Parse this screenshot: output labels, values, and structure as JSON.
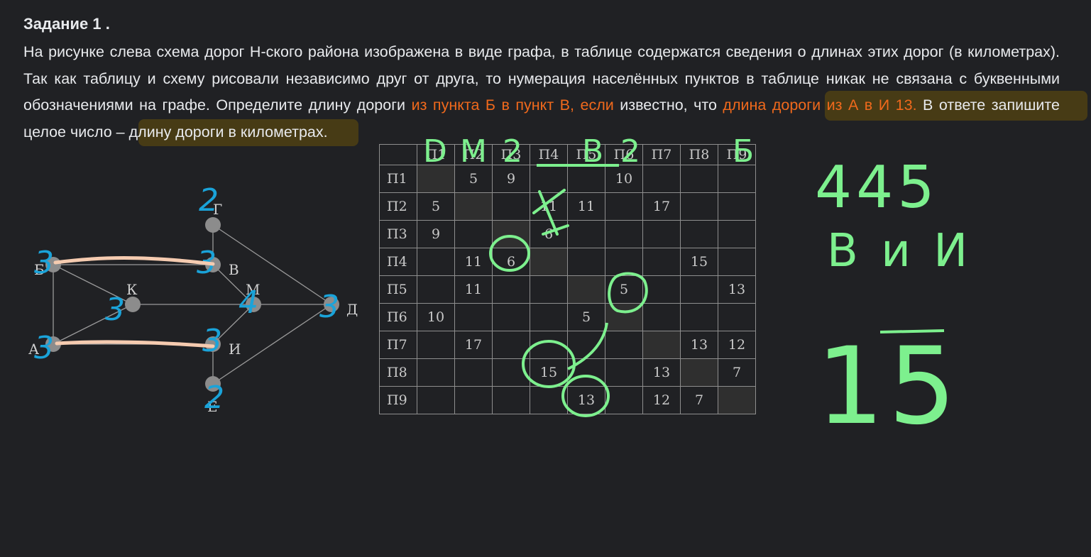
{
  "task": {
    "title": "Задание 1 .",
    "text_1": "На рисунке слева схема дорог Н-ского района изображена в виде графа, в таблице содержатся сведения о длинах этих дорог (в километрах). Так как таблицу и схему рисовали независимо друг от друга, то нумерация населённых пунктов в таблице никак не связана с буквенными обозначениями на графе. Определите длину дороги ",
    "highlight_1": "из пункта Б в пункт В, если",
    "text_2": " известно, что ",
    "highlight_2": "длина дороги из А в И 13.",
    "text_3": " В ответе запишите целое число – длину дороги в километрах."
  },
  "colors": {
    "background": "#202124",
    "text": "#e8eaed",
    "highlight": "#f0691c",
    "ink_green": "#7df08e",
    "ink_blue": "#1aa3d9",
    "ink_peach": "#f5cbb0"
  },
  "graph": {
    "nodes": [
      {
        "id": "Г",
        "label": "Г"
      },
      {
        "id": "Б",
        "label": "Б"
      },
      {
        "id": "В",
        "label": "В"
      },
      {
        "id": "К",
        "label": "К"
      },
      {
        "id": "М",
        "label": "М"
      },
      {
        "id": "Д",
        "label": "Д"
      },
      {
        "id": "А",
        "label": "А"
      },
      {
        "id": "И",
        "label": "И"
      },
      {
        "id": "Е",
        "label": "Е"
      }
    ],
    "edges": [
      [
        "Б",
        "В"
      ],
      [
        "Б",
        "К"
      ],
      [
        "Б",
        "А"
      ],
      [
        "Г",
        "В"
      ],
      [
        "Г",
        "Д"
      ],
      [
        "В",
        "М"
      ],
      [
        "К",
        "М"
      ],
      [
        "М",
        "Д"
      ],
      [
        "К",
        "А"
      ],
      [
        "А",
        "И"
      ],
      [
        "И",
        "М"
      ],
      [
        "И",
        "Е"
      ],
      [
        "Е",
        "Д"
      ]
    ],
    "annotations": {
      "degree_Г": "2",
      "degree_Б": "3",
      "degree_В": "3",
      "degree_К": "3",
      "degree_М": "4",
      "degree_Д": "3",
      "degree_А": "3",
      "degree_И": "3",
      "degree_Е": "2"
    }
  },
  "table": {
    "headers": [
      "П1",
      "П2",
      "П3",
      "П4",
      "П5",
      "П6",
      "П7",
      "П8",
      "П9"
    ],
    "rows": [
      [
        "",
        "5",
        "9",
        "",
        "",
        "10",
        "",
        "",
        ""
      ],
      [
        "5",
        "",
        "",
        "11",
        "11",
        "",
        "17",
        "",
        ""
      ],
      [
        "9",
        "",
        "",
        "6",
        "",
        "",
        "",
        "",
        ""
      ],
      [
        "",
        "11",
        "6",
        "",
        "",
        "",
        "",
        "15",
        ""
      ],
      [
        "",
        "11",
        "",
        "",
        "",
        "5",
        "",
        "",
        "13"
      ],
      [
        "10",
        "",
        "",
        "",
        "5",
        "",
        "",
        "",
        ""
      ],
      [
        "",
        "17",
        "",
        "",
        "",
        "",
        "",
        "13",
        "12"
      ],
      [
        "",
        "",
        "",
        "15",
        "",
        "",
        "13",
        "",
        "7"
      ],
      [
        "",
        "",
        "",
        "",
        "13",
        "",
        "12",
        "7",
        ""
      ]
    ]
  },
  "handwriting": {
    "col_degrees": [
      "D",
      "M",
      "2",
      "",
      "B",
      "2",
      "",
      "",
      "Б"
    ],
    "right_top": "445",
    "right_letters": "В и И",
    "answer": "15"
  }
}
